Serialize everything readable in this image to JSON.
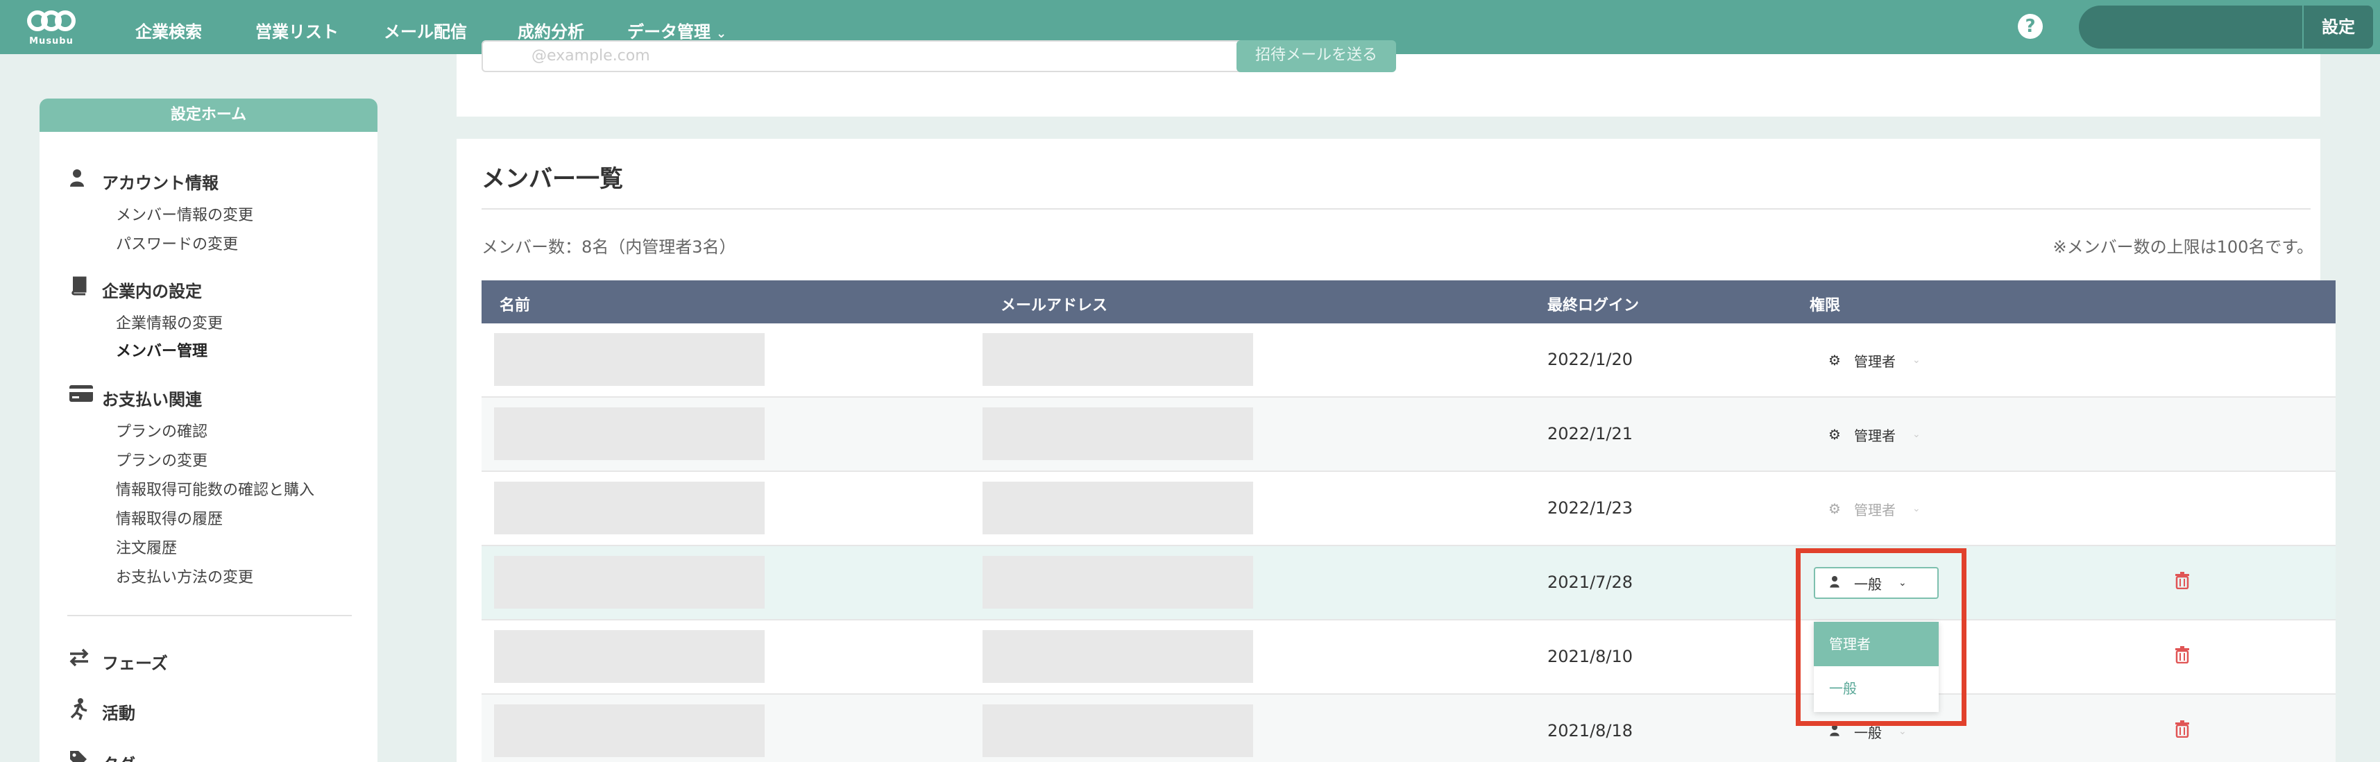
{
  "app": {
    "logo_text": "Musubu",
    "nav": [
      {
        "label": "企業検索"
      },
      {
        "label": "営業リスト"
      },
      {
        "label": "メール配信"
      },
      {
        "label": "成約分析"
      },
      {
        "label": "データ管理"
      }
    ],
    "help_icon": "question-circle-icon",
    "settings_label": "設定"
  },
  "sidebar": {
    "header": "設定ホーム",
    "sections": [
      {
        "title": "アカウント情報",
        "icon": "user-icon",
        "links": [
          "メンバー情報の変更",
          "パスワードの変更"
        ]
      },
      {
        "title": "企業内の設定",
        "icon": "book-icon",
        "links": [
          "企業情報の変更",
          "メンバー管理"
        ]
      },
      {
        "title": "お支払い関連",
        "icon": "credit-card-icon",
        "links": [
          "プランの確認",
          "プランの変更",
          "情報取得可能数の確認と購入",
          "情報取得の履歴",
          "注文履歴",
          "お支払い方法の変更"
        ]
      }
    ],
    "active_link": "メンバー管理",
    "tools": [
      {
        "label": "フェーズ",
        "icon": "exchange-icon"
      },
      {
        "label": "活動",
        "icon": "running-icon"
      },
      {
        "label": "タグ",
        "icon": "tag-icon"
      }
    ]
  },
  "invite": {
    "email_placeholder": "@example.com",
    "button_label": "招待メールを送る"
  },
  "members": {
    "title": "メンバー一覧",
    "count_text": "メンバー数：8名（内管理者3名）",
    "limit_note": "※メンバー数の上限は100名です。",
    "columns": [
      "名前",
      "メールアドレス",
      "最終ログイン",
      "権限"
    ],
    "rows": [
      {
        "last_login": "2022/1/20",
        "role": "管理者",
        "role_icon": "gear-icon"
      },
      {
        "last_login": "2022/1/21",
        "role": "管理者",
        "role_icon": "gear-icon"
      },
      {
        "last_login": "2022/1/23",
        "role": "管理者",
        "role_icon": "gear-icon"
      },
      {
        "last_login": "2021/7/28",
        "role": "一般",
        "role_icon": "user-icon"
      },
      {
        "last_login": "2021/8/10",
        "role": "一般",
        "role_icon": "user-icon"
      },
      {
        "last_login": "2021/8/18",
        "role": "一般",
        "role_icon": "user-icon"
      }
    ],
    "role_options": [
      "管理者",
      "一般"
    ],
    "open_dropdown_selected": "一般",
    "colors": {
      "header_bg": "#5d6b85",
      "accent": "#5aa898",
      "highlight": "#e1412c",
      "trash": "#e05555"
    }
  }
}
